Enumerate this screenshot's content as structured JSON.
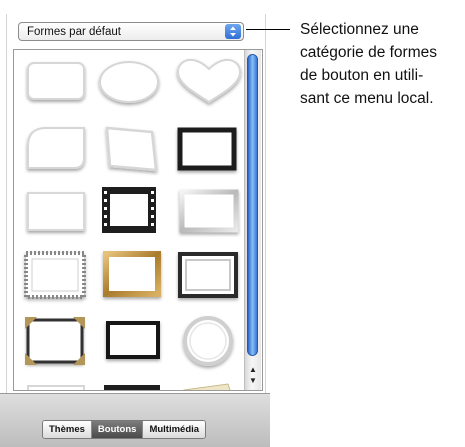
{
  "dropdown": {
    "label": "Formes par défaut"
  },
  "callout": {
    "lines": [
      "Sélectionnez une",
      "catégorie de formes",
      "de bouton en utili-",
      "sant ce menu local."
    ]
  },
  "tabs": [
    {
      "label": "Thèmes",
      "active": false
    },
    {
      "label": "Boutons",
      "active": true
    },
    {
      "label": "Multimédia",
      "active": false
    }
  ],
  "scroll_arrows": {
    "up": "▲",
    "down": "▼"
  },
  "shapes": [
    "rounded-rect-shape",
    "oval-shape",
    "heart-shape",
    "leaf-shape",
    "tilted-rect-shape",
    "black-frame",
    "plain-rect-shape",
    "film-strip-frame",
    "silver-frame",
    "stamp-frame",
    "gold-frame",
    "black-silver-frame",
    "photo-corner-frame",
    "thin-black-frame",
    "circle-frame"
  ]
}
